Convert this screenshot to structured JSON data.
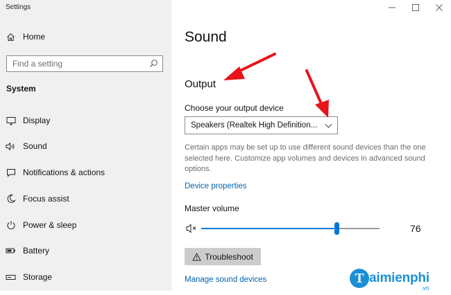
{
  "window": {
    "title": "Settings",
    "controls": {
      "minimize": "minimize-icon",
      "maximize": "maximize-icon",
      "close": "close-icon"
    }
  },
  "sidebar": {
    "home_label": "Home",
    "search": {
      "placeholder": "Find a setting",
      "value": ""
    },
    "category": "System",
    "items": [
      {
        "label": "Display",
        "icon": "monitor-icon"
      },
      {
        "label": "Sound",
        "icon": "speaker-icon"
      },
      {
        "label": "Notifications & actions",
        "icon": "notification-icon"
      },
      {
        "label": "Focus assist",
        "icon": "moon-icon"
      },
      {
        "label": "Power & sleep",
        "icon": "power-icon"
      },
      {
        "label": "Battery",
        "icon": "battery-icon"
      },
      {
        "label": "Storage",
        "icon": "storage-icon"
      }
    ]
  },
  "main": {
    "title": "Sound",
    "output": {
      "heading": "Output",
      "choose_label": "Choose your output device",
      "selected_device": "Speakers (Realtek High Definition...",
      "description": "Certain apps may be set up to use different sound devices than the one selected here. Customize app volumes and devices in advanced sound options.",
      "device_properties_link": "Device properties",
      "master_volume_label": "Master volume",
      "volume": 76,
      "troubleshoot_label": "Troubleshoot",
      "manage_devices_link": "Manage sound devices"
    }
  },
  "annotations": {
    "arrow_color": "#e8141b"
  },
  "watermark": {
    "brand_initial": "T",
    "brand_text": "aimienphi",
    "brand_suffix": ".vn"
  },
  "colors": {
    "accent": "#0078d7",
    "link": "#0063b1",
    "sidebar_bg": "#f0f0f0"
  }
}
